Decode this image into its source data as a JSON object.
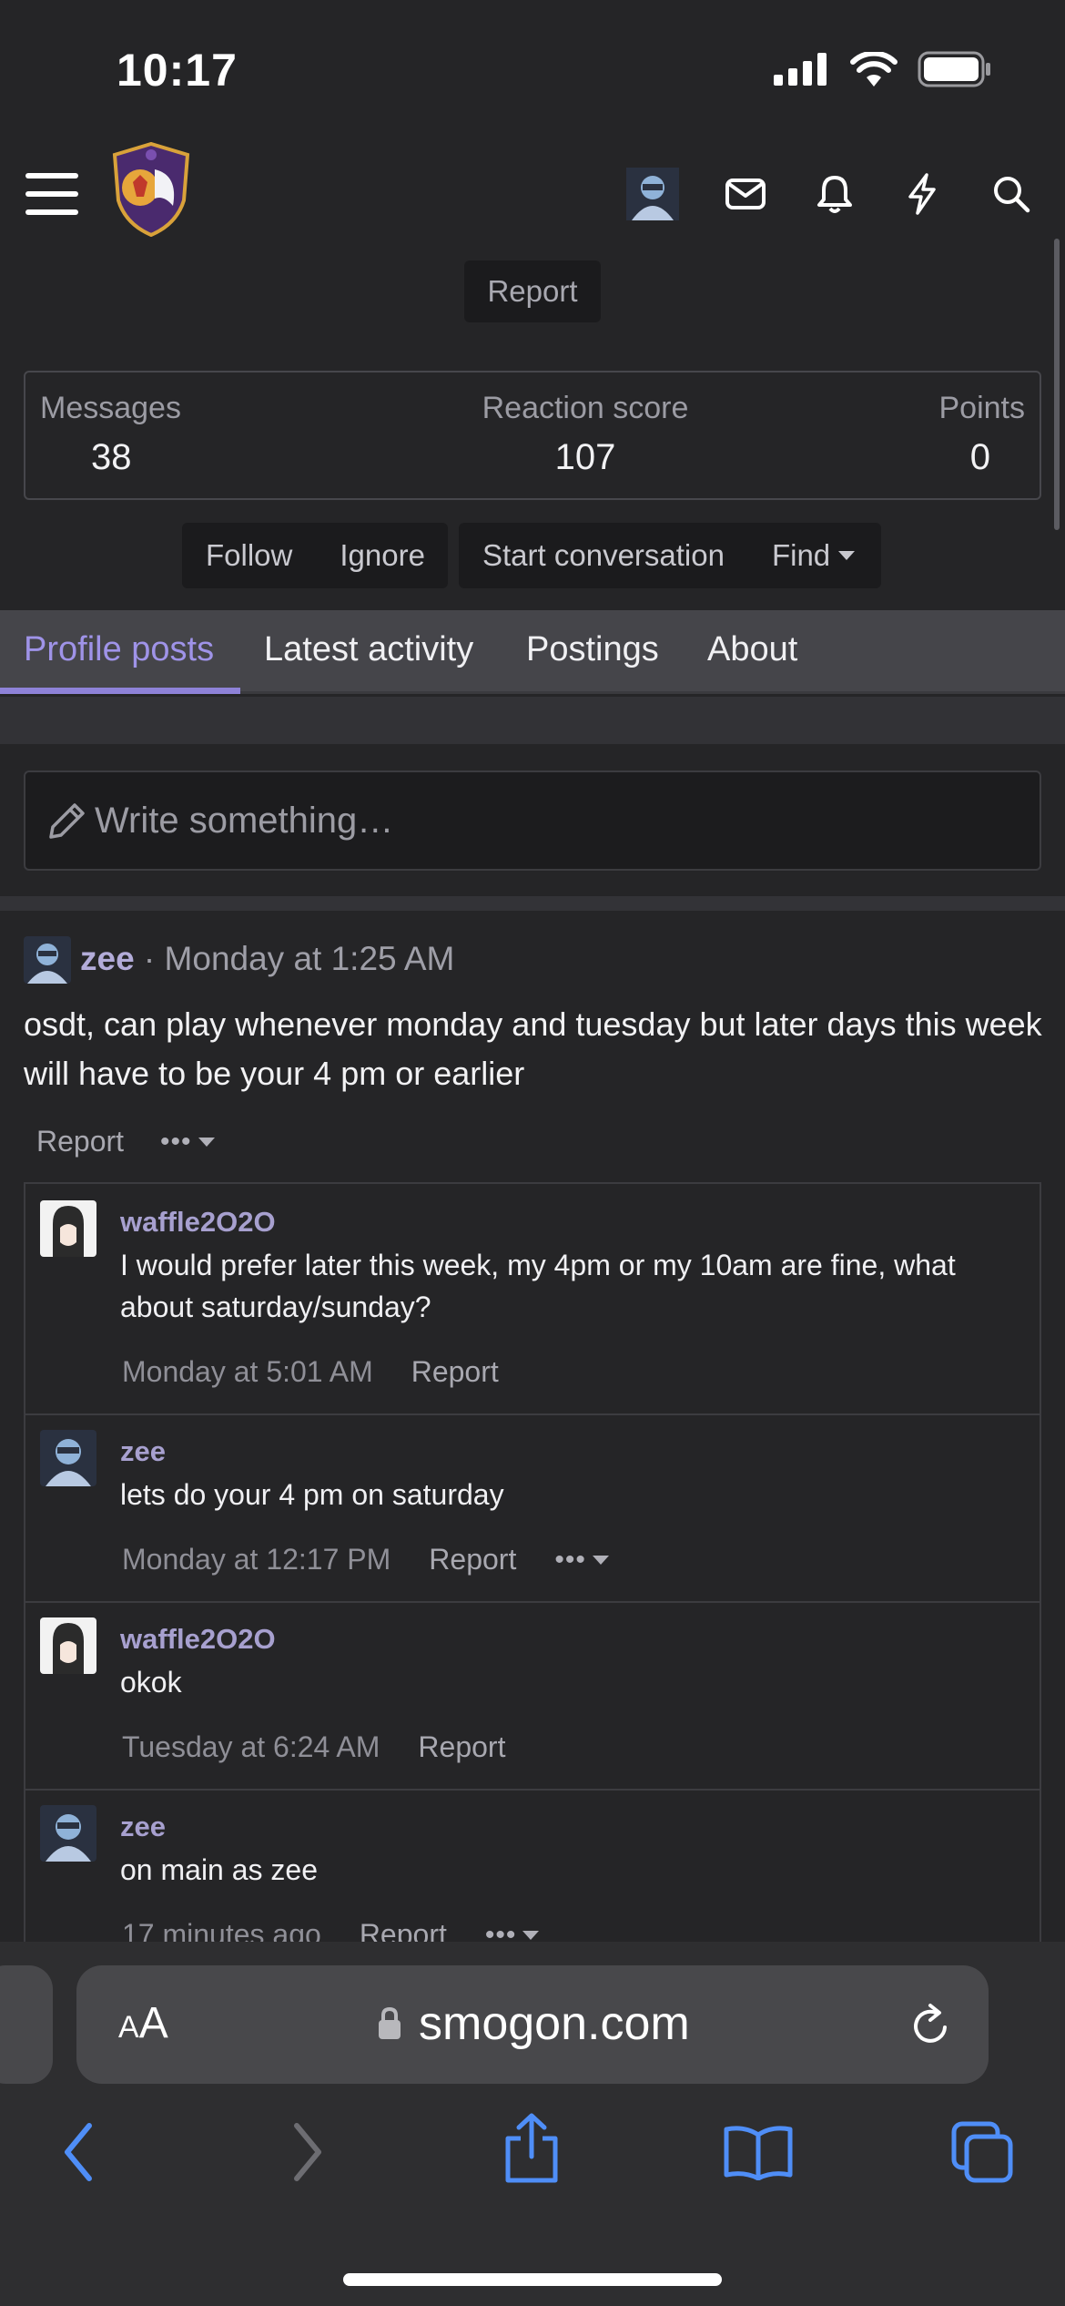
{
  "status_bar": {
    "time": "10:17"
  },
  "nav": {
    "menu_icon": "hamburger-icon",
    "logo": "smogon-logo",
    "icons": [
      "avatar",
      "mail-icon",
      "bell-icon",
      "lightning-icon",
      "search-icon"
    ]
  },
  "profile": {
    "report_label": "Report",
    "stats": {
      "messages_label": "Messages",
      "messages_value": "38",
      "reaction_label": "Reaction score",
      "reaction_value": "107",
      "points_label": "Points",
      "points_value": "0"
    },
    "actions": {
      "follow": "Follow",
      "ignore": "Ignore",
      "start_conversation": "Start conversation",
      "find": "Find"
    }
  },
  "tabs": [
    {
      "label": "Profile posts",
      "active": true
    },
    {
      "label": "Latest activity",
      "active": false
    },
    {
      "label": "Postings",
      "active": false
    },
    {
      "label": "About",
      "active": false
    }
  ],
  "composer": {
    "placeholder": "Write something…"
  },
  "post": {
    "user": "zee",
    "separator": " · ",
    "time": "Monday at 1:25 AM",
    "body": "osdt, can play whenever monday and tuesday but later days this week will have to be your 4 pm or earlier",
    "report": "Report",
    "more": "•••"
  },
  "comments": [
    {
      "user": "waffle2O2O",
      "text": "I would prefer later this week, my 4pm or my 10am are fine, what about saturday/sunday?",
      "time": "Monday at 5:01 AM",
      "report": "Report",
      "more": false
    },
    {
      "user": "zee",
      "text": "lets do your 4 pm on saturday",
      "time": "Monday at 12:17 PM",
      "report": "Report",
      "more": true
    },
    {
      "user": "waffle2O2O",
      "text": "okok",
      "time": "Tuesday at 6:24 AM",
      "report": "Report",
      "more": false
    },
    {
      "user": "zee",
      "text": "on main as zee",
      "time": "17 minutes ago",
      "report": "Report",
      "more": true
    }
  ],
  "more_dots": "•••",
  "browser": {
    "text_size_label_a1": "A",
    "text_size_label_a2": "A",
    "url": "smogon.com"
  },
  "colors": {
    "accent": "#9f93e8",
    "background": "#252527",
    "tab_bar": "#45454a"
  }
}
